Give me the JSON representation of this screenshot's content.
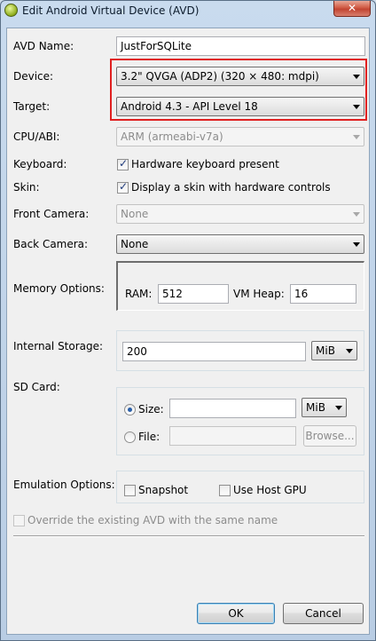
{
  "window": {
    "title": "Edit Android Virtual Device (AVD)",
    "close_label": "✕"
  },
  "avd_name": {
    "label": "AVD Name:",
    "value": "JustForSQLite"
  },
  "device": {
    "label": "Device:",
    "value": "3.2\" QVGA (ADP2) (320 × 480: mdpi)"
  },
  "target": {
    "label": "Target:",
    "value": "Android 4.3 - API Level 18"
  },
  "cpu_abi": {
    "label": "CPU/ABI:",
    "value": "ARM (armeabi-v7a)"
  },
  "keyboard": {
    "label": "Keyboard:",
    "option": "Hardware keyboard present",
    "checked": true
  },
  "skin": {
    "label": "Skin:",
    "option": "Display a skin with hardware controls",
    "checked": true
  },
  "front_camera": {
    "label": "Front Camera:",
    "value": "None"
  },
  "back_camera": {
    "label": "Back Camera:",
    "value": "None"
  },
  "memory": {
    "label": "Memory Options:",
    "ram_label": "RAM:",
    "ram_value": "512",
    "vm_heap_label": "VM Heap:",
    "vm_heap_value": "16"
  },
  "internal_storage": {
    "label": "Internal Storage:",
    "value": "200",
    "unit": "MiB"
  },
  "sd_card": {
    "label": "SD Card:",
    "size_label": "Size:",
    "size_value": "",
    "size_unit": "MiB",
    "file_label": "File:",
    "file_value": "",
    "browse_label": "Browse...",
    "selected": "size"
  },
  "emulation": {
    "label": "Emulation Options:",
    "snapshot_label": "Snapshot",
    "snapshot_checked": false,
    "gpu_label": "Use Host GPU",
    "gpu_checked": false
  },
  "override": {
    "label": "Override the existing AVD with the same name",
    "checked": false
  },
  "buttons": {
    "ok": "OK",
    "cancel": "Cancel"
  }
}
